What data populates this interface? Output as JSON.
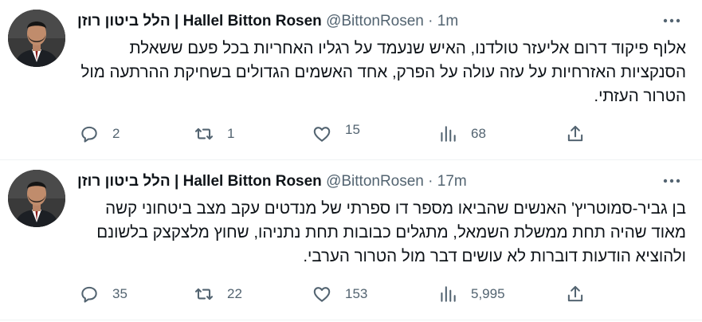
{
  "tweets": [
    {
      "name": "הלל ביטון רוזן | Hallel Bitton Rosen",
      "handle": "@BittonRosen",
      "separator": "·",
      "time": "1m",
      "text": "אלוף פיקוד דרום אליעזר טולדנו, האיש שנעמד על רגליו האחריות בכל פעם ששאלת הסנקציות האזרחיות על עזה עולה על הפרק, אחד האשמים הגדולים בשחיקת ההרתעה מול הטרור העזתי.",
      "replies": "2",
      "retweets": "1",
      "likes": "15",
      "views": "68"
    },
    {
      "name": "הלל ביטון רוזן | Hallel Bitton Rosen",
      "handle": "@BittonRosen",
      "separator": "·",
      "time": "17m",
      "text": "בן גביר-סמוטריץ' האנשים שהביאו מספר דו ספרתי של מנדטים עקב מצב ביטחוני קשה מאוד שהיה תחת ממשלת השמאל, מתגלים כבובות תחת נתניהו, שחוץ מלצקצק בלשונם ולהוציא הודעות דוברות לא עושים דבר מול הטרור הערבי.",
      "replies": "35",
      "retweets": "22",
      "likes": "153",
      "views": "5,995"
    }
  ],
  "icons": {
    "more": "more-horizontal-icon",
    "reply": "reply-bubble-icon",
    "retweet": "retweet-arrows-icon",
    "like": "heart-icon",
    "views": "views-bar-chart-icon",
    "share": "share-upload-icon"
  },
  "colors": {
    "text": "#0f1419",
    "secondary": "#536471",
    "divider": "#eff3f4"
  }
}
